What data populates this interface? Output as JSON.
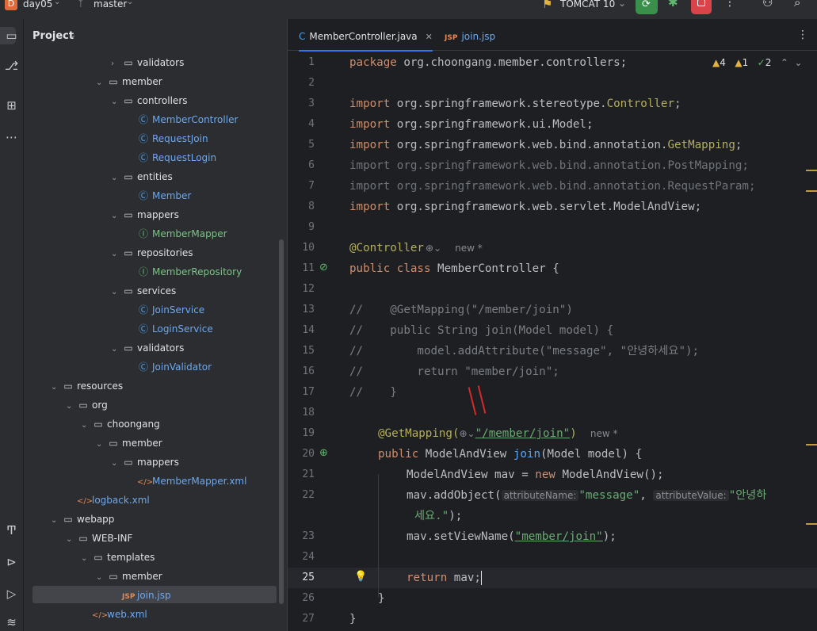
{
  "topbar": {
    "project_badge": "D",
    "project_name": "day05",
    "branch": "master",
    "run_config": "TOMCAT 10"
  },
  "project_panel": {
    "title": "Project",
    "tree": [
      {
        "label": "validators",
        "type": "folder",
        "depth": 6,
        "expanded": false
      },
      {
        "label": "member",
        "type": "folder",
        "depth": 5,
        "expanded": true
      },
      {
        "label": "controllers",
        "type": "folder",
        "depth": 6,
        "expanded": true
      },
      {
        "label": "MemberController",
        "type": "class",
        "depth": 7
      },
      {
        "label": "RequestJoin",
        "type": "class",
        "depth": 7
      },
      {
        "label": "RequestLogin",
        "type": "class",
        "depth": 7
      },
      {
        "label": "entities",
        "type": "folder",
        "depth": 6,
        "expanded": true
      },
      {
        "label": "Member",
        "type": "class",
        "depth": 7
      },
      {
        "label": "mappers",
        "type": "folder",
        "depth": 6,
        "expanded": true
      },
      {
        "label": "MemberMapper",
        "type": "interface",
        "depth": 7
      },
      {
        "label": "repositories",
        "type": "folder",
        "depth": 6,
        "expanded": true
      },
      {
        "label": "MemberRepository",
        "type": "interface",
        "depth": 7
      },
      {
        "label": "services",
        "type": "folder",
        "depth": 6,
        "expanded": true
      },
      {
        "label": "JoinService",
        "type": "class",
        "depth": 7
      },
      {
        "label": "LoginService",
        "type": "class",
        "depth": 7
      },
      {
        "label": "validators",
        "type": "folder",
        "depth": 6,
        "expanded": true
      },
      {
        "label": "JoinValidator",
        "type": "class",
        "depth": 7
      },
      {
        "label": "resources",
        "type": "folder",
        "depth": 2,
        "expanded": true
      },
      {
        "label": "org",
        "type": "folder",
        "depth": 3,
        "expanded": true
      },
      {
        "label": "choongang",
        "type": "folder",
        "depth": 4,
        "expanded": true
      },
      {
        "label": "member",
        "type": "folder",
        "depth": 5,
        "expanded": true
      },
      {
        "label": "mappers",
        "type": "folder",
        "depth": 6,
        "expanded": true
      },
      {
        "label": "MemberMapper.xml",
        "type": "xml",
        "depth": 7
      },
      {
        "label": "logback.xml",
        "type": "xml",
        "depth": 3
      },
      {
        "label": "webapp",
        "type": "folder",
        "depth": 2,
        "expanded": true
      },
      {
        "label": "WEB-INF",
        "type": "folder",
        "depth": 3,
        "expanded": true
      },
      {
        "label": "templates",
        "type": "folder",
        "depth": 4,
        "expanded": true
      },
      {
        "label": "member",
        "type": "folder",
        "depth": 5,
        "expanded": true
      },
      {
        "label": "join.jsp",
        "type": "jsp",
        "depth": 6,
        "selected": true
      },
      {
        "label": "web.xml",
        "type": "xml",
        "depth": 4
      }
    ]
  },
  "editor": {
    "tabs": [
      {
        "label": "MemberController.java",
        "icon": "C",
        "active": true
      },
      {
        "label": "join.jsp",
        "icon": "JSP",
        "active": false
      }
    ],
    "inspections": {
      "warnings": "4",
      "weak_warnings": "1",
      "ok": "2"
    },
    "line_numbers": [
      "1",
      "2",
      "3",
      "4",
      "5",
      "6",
      "7",
      "8",
      "9",
      "10",
      "11",
      "12",
      "13",
      "14",
      "15",
      "16",
      "17",
      "18",
      "19",
      "20",
      "21",
      "22",
      "",
      "23",
      "24",
      "25",
      "26",
      "27"
    ],
    "code": {
      "l1_kw": "package",
      "l1_rest": " org.choongang.member.controllers;",
      "import": "import",
      "l3_pkg": " org.springframework.stereotype.",
      "l3_cls": "Controller",
      "semi": ";",
      "l4": " org.springframework.ui.Model;",
      "l5_pkg": " org.springframework.web.bind.annotation.",
      "l5_cls": "GetMapping",
      "l6": " org.springframework.web.bind.annotation.PostMapping;",
      "l7": " org.springframework.web.bind.annotation.RequestParam;",
      "l8": " org.springframework.web.servlet.ModelAndView;",
      "l10_ann": "@Controller",
      "l10_hint": "new *",
      "l11_kw1": "public",
      "l11_kw2": "class",
      "l11_rest": " MemberController {",
      "l13": "//    @GetMapping(\"/member/join\")",
      "l14": "//    public String join(Model model) {",
      "l15": "//        model.addAttribute(\"message\", \"안녕하세요\");",
      "l16": "//        return \"member/join\";",
      "l17": "//    }",
      "l19_ann": "@GetMapping(",
      "l19_str": "\"/member/join\"",
      "l19_close": ")",
      "l19_hint": "new *",
      "l20_kw": "public",
      "l20_type": " ModelAndView ",
      "l20_fn": "join",
      "l20_rest": "(Model model) {",
      "l21_a": "ModelAndView mav = ",
      "l21_kw": "new",
      "l21_b": " ModelAndView();",
      "l22_a": "mav.addObject(",
      "l22_hint1": "attributeName:",
      "l22_str1": "\"message\"",
      "l22_comma": ", ",
      "l22_hint2": "attributeValue:",
      "l22_str2a": "\"안녕하",
      "l22w_str": "세요.\"",
      "l22w_rest": ");",
      "l23_a": "mav.setViewName(",
      "l23_str": "\"member/join\"",
      "l23_b": ");",
      "l25_kw": "return",
      "l25_rest": " mav;",
      "l26": "}",
      "l27": "}"
    }
  }
}
